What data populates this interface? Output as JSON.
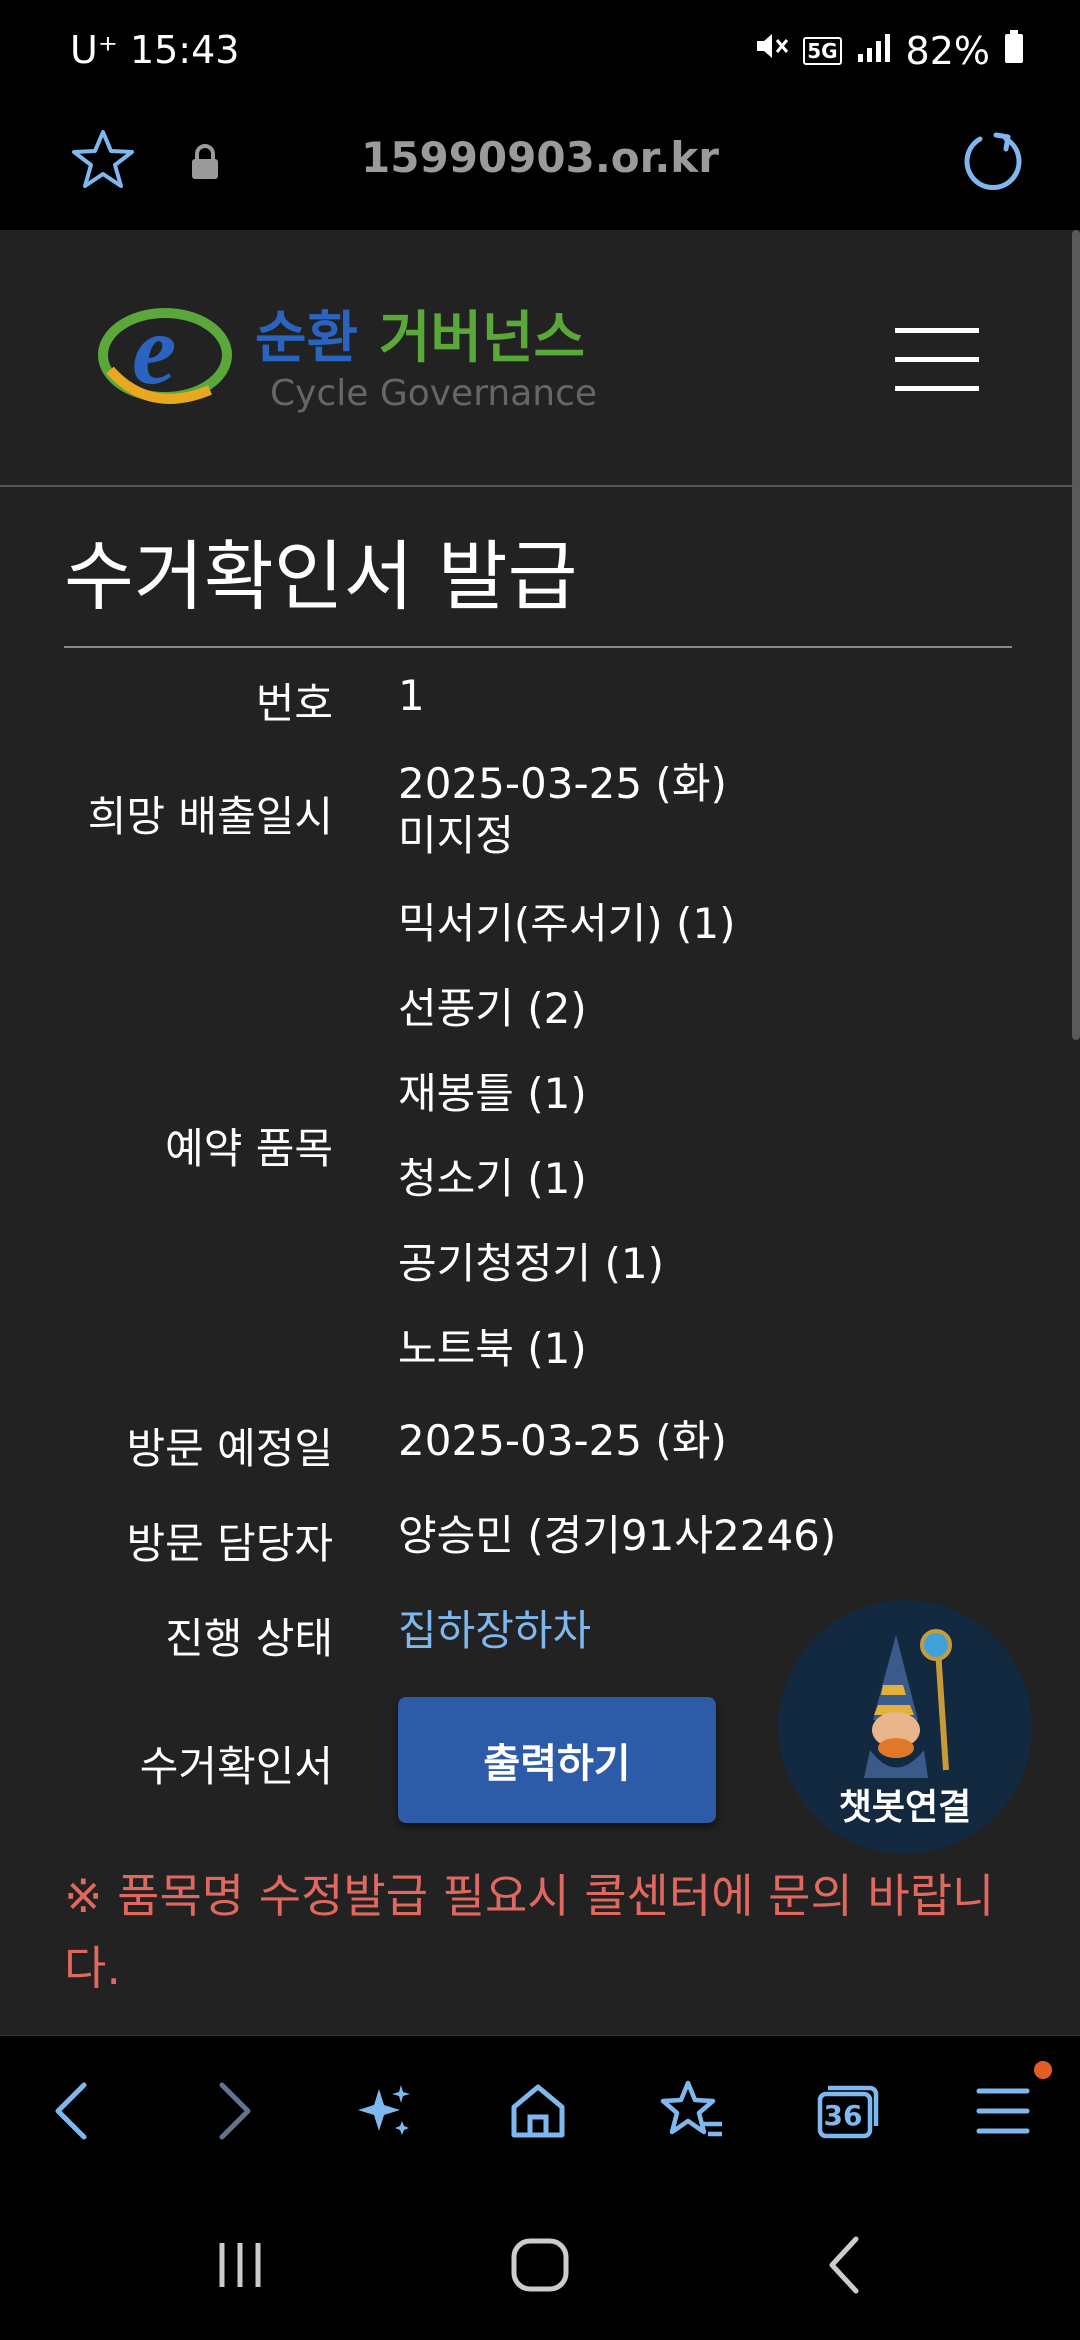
{
  "status_bar": {
    "carrier_time": "U⁺ 15:43",
    "network": "5G",
    "battery": "82%",
    "icons": [
      "mute-icon",
      "5g-icon",
      "signal-icon",
      "battery-icon"
    ]
  },
  "browser": {
    "url": "15990903.or.kr",
    "icons": [
      "star-icon",
      "lock-icon",
      "reload-icon"
    ]
  },
  "site": {
    "logo_title_part1": "순환",
    "logo_title_part2": "거버넌스",
    "logo_subtitle": "Cycle Governance",
    "menu_icon": "hamburger-icon"
  },
  "page": {
    "title": "수거확인서 발급",
    "rows": {
      "number": {
        "label": "번호",
        "value": "1"
      },
      "desired_date": {
        "label": "희망 배출일시",
        "value_line1": "2025-03-25 (화)",
        "value_line2": "미지정"
      },
      "items": {
        "label": "예약 품목",
        "values": [
          "믹서기(주서기) (1)",
          "선풍기 (2)",
          "재봉틀 (1)",
          "청소기 (1)",
          "공기청정기 (1)",
          "노트북 (1)"
        ]
      },
      "visit_date": {
        "label": "방문 예정일",
        "value": "2025-03-25 (화)"
      },
      "visit_staff": {
        "label": "방문 담당자",
        "value": "양승민 (경기91사2246)"
      },
      "status": {
        "label": "진행 상태",
        "value": "집하장하차"
      },
      "certificate": {
        "label": "수거확인서",
        "button": "출력하기"
      }
    },
    "notice": "※ 품목명 수정발급 필요시 콜센터에 문의 바랍니다.",
    "chatbot_label": "챗봇연결"
  },
  "toolbar": {
    "tab_count": "36",
    "icons": [
      "back-icon",
      "forward-icon",
      "sparkle-icon",
      "home-icon",
      "bookmarks-icon",
      "tabs-icon",
      "menu-icon"
    ]
  },
  "colors": {
    "page_bg": "#222222",
    "accent_button": "#2d5ba8",
    "status_link": "#7fb8ee",
    "notice": "#e0685e"
  }
}
